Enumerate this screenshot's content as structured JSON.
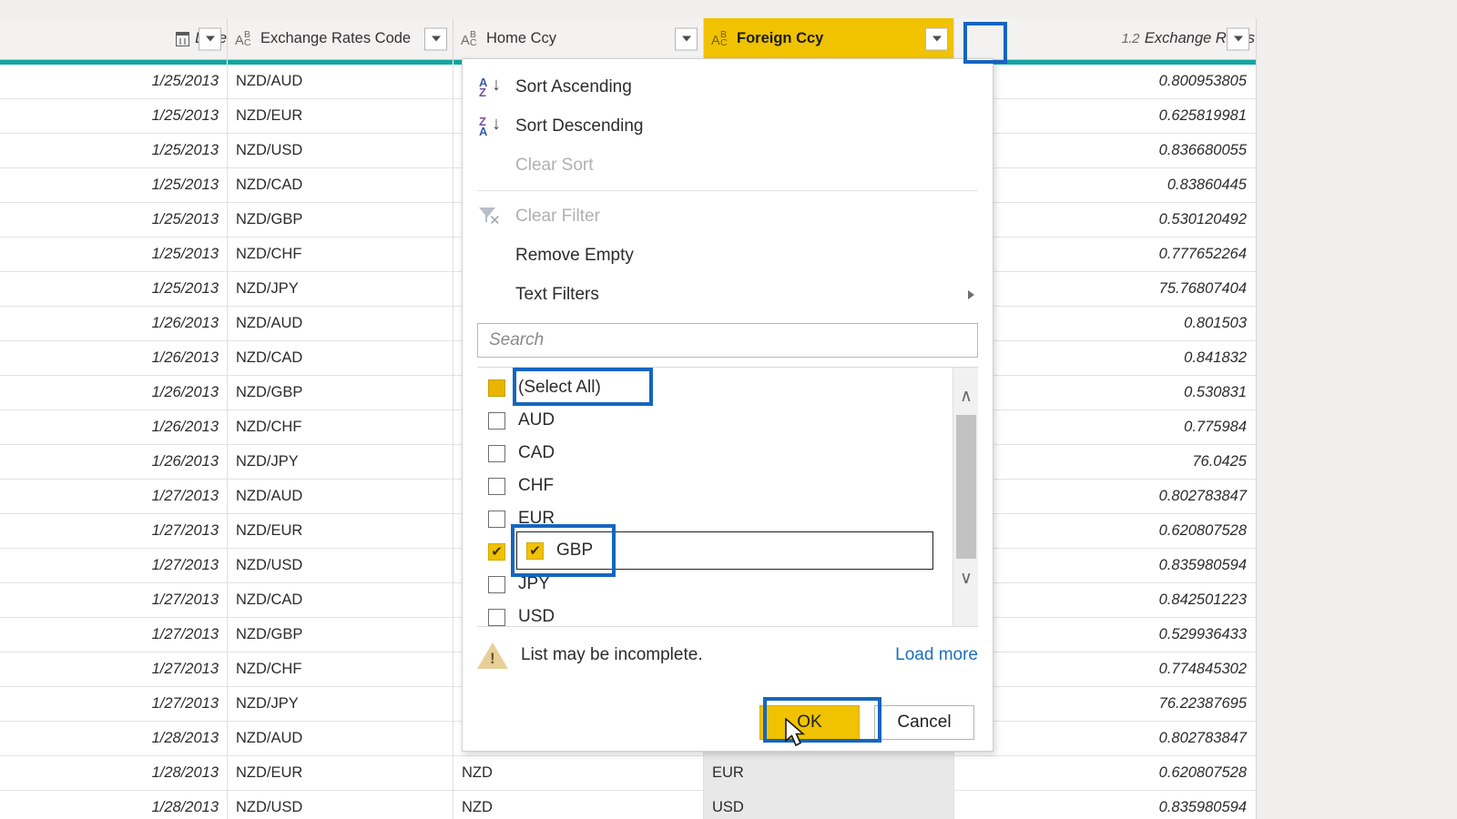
{
  "app": {
    "accent_yellow": "#f0c200",
    "accent_teal": "#13a5a0",
    "highlight_blue": "#1565c0",
    "link_blue": "#1a6fc4"
  },
  "table": {
    "columns": [
      {
        "label": "Date",
        "type_icon": "calendar-icon",
        "type_text": ""
      },
      {
        "label": "Exchange Rates Code",
        "type_icon": "abc-text-icon",
        "type_text": "ABC"
      },
      {
        "label": "Home Ccy",
        "type_icon": "abc-text-icon",
        "type_text": "ABC"
      },
      {
        "label": "Foreign Ccy",
        "type_icon": "abc-text-icon",
        "type_text": "ABC"
      },
      {
        "label": "Exchange Rates",
        "type_icon": "decimal-number-icon",
        "type_text": "1.2"
      }
    ],
    "rows": [
      {
        "date": "1/25/2013",
        "code": "NZD/AUD",
        "home": "",
        "foreign": "",
        "rate": "0.800953805"
      },
      {
        "date": "1/25/2013",
        "code": "NZD/EUR",
        "home": "",
        "foreign": "",
        "rate": "0.625819981"
      },
      {
        "date": "1/25/2013",
        "code": "NZD/USD",
        "home": "",
        "foreign": "",
        "rate": "0.836680055"
      },
      {
        "date": "1/25/2013",
        "code": "NZD/CAD",
        "home": "",
        "foreign": "",
        "rate": "0.83860445"
      },
      {
        "date": "1/25/2013",
        "code": "NZD/GBP",
        "home": "",
        "foreign": "",
        "rate": "0.530120492"
      },
      {
        "date": "1/25/2013",
        "code": "NZD/CHF",
        "home": "",
        "foreign": "",
        "rate": "0.777652264"
      },
      {
        "date": "1/25/2013",
        "code": "NZD/JPY",
        "home": "",
        "foreign": "",
        "rate": "75.76807404"
      },
      {
        "date": "1/26/2013",
        "code": "NZD/AUD",
        "home": "",
        "foreign": "",
        "rate": "0.801503"
      },
      {
        "date": "1/26/2013",
        "code": "NZD/CAD",
        "home": "",
        "foreign": "",
        "rate": "0.841832"
      },
      {
        "date": "1/26/2013",
        "code": "NZD/GBP",
        "home": "",
        "foreign": "",
        "rate": "0.530831"
      },
      {
        "date": "1/26/2013",
        "code": "NZD/CHF",
        "home": "",
        "foreign": "",
        "rate": "0.775984"
      },
      {
        "date": "1/26/2013",
        "code": "NZD/JPY",
        "home": "",
        "foreign": "",
        "rate": "76.0425"
      },
      {
        "date": "1/27/2013",
        "code": "NZD/AUD",
        "home": "",
        "foreign": "",
        "rate": "0.802783847"
      },
      {
        "date": "1/27/2013",
        "code": "NZD/EUR",
        "home": "",
        "foreign": "",
        "rate": "0.620807528"
      },
      {
        "date": "1/27/2013",
        "code": "NZD/USD",
        "home": "",
        "foreign": "",
        "rate": "0.835980594"
      },
      {
        "date": "1/27/2013",
        "code": "NZD/CAD",
        "home": "",
        "foreign": "",
        "rate": "0.842501223"
      },
      {
        "date": "1/27/2013",
        "code": "NZD/GBP",
        "home": "",
        "foreign": "",
        "rate": "0.529936433"
      },
      {
        "date": "1/27/2013",
        "code": "NZD/CHF",
        "home": "",
        "foreign": "",
        "rate": "0.774845302"
      },
      {
        "date": "1/27/2013",
        "code": "NZD/JPY",
        "home": "",
        "foreign": "",
        "rate": "76.22387695"
      },
      {
        "date": "1/28/2013",
        "code": "NZD/AUD",
        "home": "",
        "foreign": "",
        "rate": "0.802783847"
      },
      {
        "date": "1/28/2013",
        "code": "NZD/EUR",
        "home": "NZD",
        "foreign": "EUR",
        "rate": "0.620807528"
      },
      {
        "date": "1/28/2013",
        "code": "NZD/USD",
        "home": "NZD",
        "foreign": "USD",
        "rate": "0.835980594"
      }
    ]
  },
  "filter_panel": {
    "menu": [
      {
        "label": "Sort Ascending",
        "icon": "sort-ascending-icon",
        "disabled": false,
        "top": "A",
        "bottom": "Z"
      },
      {
        "label": "Sort Descending",
        "icon": "sort-descending-icon",
        "disabled": false,
        "top": "Z",
        "bottom": "A"
      },
      {
        "label": "Clear Sort",
        "icon": "none",
        "disabled": true
      },
      {
        "label": "Clear Filter",
        "icon": "clear-filter-icon",
        "disabled": true
      },
      {
        "label": "Remove Empty",
        "icon": "none",
        "disabled": false
      },
      {
        "label": "Text Filters",
        "icon": "none",
        "disabled": false,
        "submenu": true
      }
    ],
    "search": {
      "placeholder": "Search",
      "value": ""
    },
    "items": [
      {
        "label": "(Select All)",
        "state": "partial"
      },
      {
        "label": "AUD",
        "state": "unchecked"
      },
      {
        "label": "CAD",
        "state": "unchecked"
      },
      {
        "label": "CHF",
        "state": "unchecked"
      },
      {
        "label": "EUR",
        "state": "unchecked"
      },
      {
        "label": "GBP",
        "state": "checked"
      },
      {
        "label": "JPY",
        "state": "unchecked"
      },
      {
        "label": "USD",
        "state": "unchecked"
      }
    ],
    "checkmark_glyph": "✔",
    "incomplete_text": "List may be incomplete.",
    "load_more_label": "Load more",
    "ok_label": "OK",
    "cancel_label": "Cancel",
    "scroll_up_glyph": "∧",
    "scroll_down_glyph": "∨"
  }
}
